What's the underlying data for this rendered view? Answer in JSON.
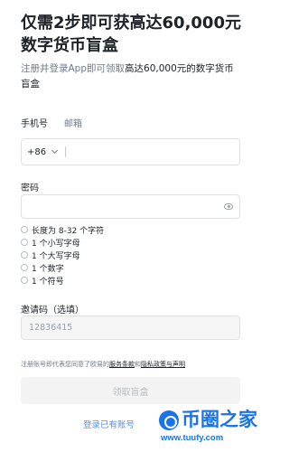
{
  "header": {
    "title": "仅需2步即可获高达60,000元数字货币盲盒",
    "subtitle_prefix": "注册并登录App即可领取",
    "subtitle_highlight": "高达60,000元的数字货币盲盒"
  },
  "tabs": [
    {
      "label": "手机号",
      "active": true
    },
    {
      "label": "邮箱",
      "active": false
    }
  ],
  "phone": {
    "country_code": "+86",
    "value": ""
  },
  "password": {
    "label": "密码",
    "value": "",
    "rules": [
      "长度为 8-32 个字符",
      "1 个小写字母",
      "1 个大写字母",
      "1 个数字",
      "1 个符号"
    ]
  },
  "referral": {
    "label": "邀请码（选填）",
    "value": "12836415"
  },
  "terms": {
    "prefix": "注册账号即代表您同意了欧易的",
    "link1": "服务条款",
    "joiner": "和",
    "link2": "隐私政策与声明"
  },
  "submit_label": "领取盲盒",
  "login_link": "登录已有账号",
  "watermark": {
    "name": "币圈之家",
    "url": "www.tuufy.com",
    "color": "#1a73e8"
  }
}
